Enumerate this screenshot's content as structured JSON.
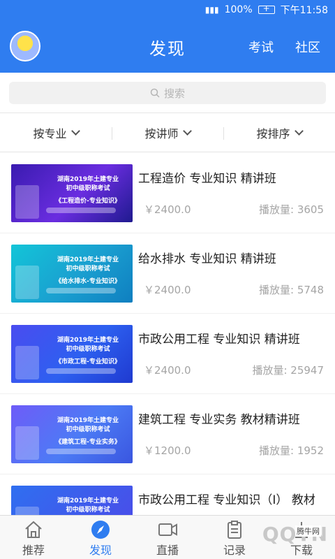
{
  "status_bar": {
    "battery": "100%",
    "time": "下午11:58"
  },
  "header": {
    "title": "发现",
    "exam": "考试",
    "community": "社区"
  },
  "search": {
    "placeholder": "搜索"
  },
  "filters": [
    {
      "label": "按专业"
    },
    {
      "label": "按讲师"
    },
    {
      "label": "按排序"
    }
  ],
  "courses": [
    {
      "title": "工程造价 专业知识 精讲班",
      "price": "￥2400.0",
      "plays": "播放量: 3605",
      "thumb_line1": "湖南2019年土建专业",
      "thumb_line2": "初中级职称考试",
      "thumb_subject": "《工程造价-专业知识》"
    },
    {
      "title": "给水排水 专业知识 精讲班",
      "price": "￥2400.0",
      "plays": "播放量: 5748",
      "thumb_line1": "湖南2019年土建专业",
      "thumb_line2": "初中级职称考试",
      "thumb_subject": "《给水排水-专业知识》"
    },
    {
      "title": "市政公用工程 专业知识 精讲班",
      "price": "￥2400.0",
      "plays": "播放量: 25947",
      "thumb_line1": "湖南2019年土建专业",
      "thumb_line2": "初中级职称考试",
      "thumb_subject": "《市政工程-专业知识》"
    },
    {
      "title": "建筑工程 专业实务 教材精讲班",
      "price": "￥1200.0",
      "plays": "播放量: 1952",
      "thumb_line1": "湖南2019年土建专业",
      "thumb_line2": "初中级职称考试",
      "thumb_subject": "《建筑工程-专业实务》"
    },
    {
      "title": "市政公用工程 专业知识（I） 教材",
      "price": "",
      "plays": "",
      "thumb_line1": "湖南2019年土建专业",
      "thumb_line2": "初中级职称考试",
      "thumb_subject": ""
    }
  ],
  "tabs": [
    {
      "label": "推荐",
      "icon": "home-icon"
    },
    {
      "label": "发现",
      "icon": "compass-icon"
    },
    {
      "label": "直播",
      "icon": "video-icon"
    },
    {
      "label": "记录",
      "icon": "clipboard-icon"
    },
    {
      "label": "下载",
      "icon": "download-icon"
    }
  ],
  "watermark": {
    "text": "QQTN",
    "badge": "腾牛网"
  },
  "colors": {
    "primary": "#2f7df0",
    "muted": "#a5a5a5"
  }
}
